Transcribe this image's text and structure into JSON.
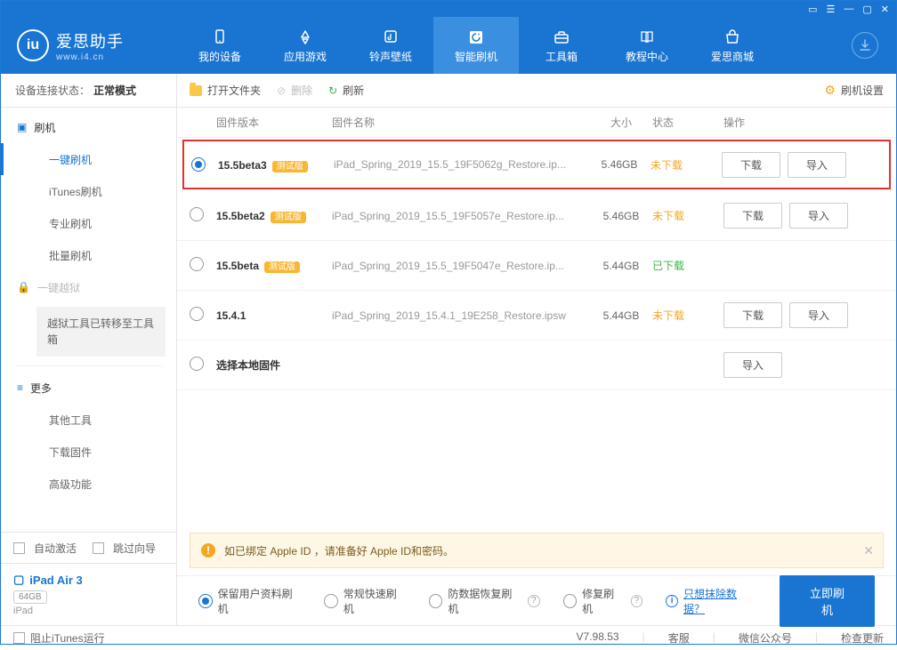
{
  "titlebar_icons": [
    "book",
    "menu",
    "min",
    "max",
    "close"
  ],
  "app": {
    "name": "爱思助手",
    "domain": "www.i4.cn"
  },
  "toptabs": [
    {
      "label": "我的设备",
      "icon": "device"
    },
    {
      "label": "应用游戏",
      "icon": "app"
    },
    {
      "label": "铃声壁纸",
      "icon": "music"
    },
    {
      "label": "智能刷机",
      "icon": "refresh",
      "active": true
    },
    {
      "label": "工具箱",
      "icon": "toolbox"
    },
    {
      "label": "教程中心",
      "icon": "book"
    },
    {
      "label": "爱思商城",
      "icon": "shop"
    }
  ],
  "sidebar": {
    "status_label": "设备连接状态：",
    "status_value": "正常模式",
    "groups": [
      {
        "head": "刷机",
        "icon": "phone",
        "subs": [
          {
            "label": "一键刷机",
            "active": true
          },
          {
            "label": "iTunes刷机"
          },
          {
            "label": "专业刷机"
          },
          {
            "label": "批量刷机"
          }
        ]
      },
      {
        "head": "一键越狱",
        "icon": "lock",
        "disabled": true,
        "notice": "越狱工具已转移至工具箱"
      },
      {
        "head": "更多",
        "icon": "more",
        "subs": [
          {
            "label": "其他工具"
          },
          {
            "label": "下载固件"
          },
          {
            "label": "高级功能"
          }
        ]
      }
    ],
    "auto_activate": "自动激活",
    "skip_guide": "跳过向导",
    "device": {
      "name": "iPad Air 3",
      "storage": "64GB",
      "type": "iPad"
    }
  },
  "toolbar": {
    "open": "打开文件夹",
    "delete": "删除",
    "refresh": "刷新",
    "settings": "刷机设置"
  },
  "columns": {
    "ver": "固件版本",
    "name": "固件名称",
    "size": "大小",
    "status": "状态",
    "ops": "操作"
  },
  "firmware": [
    {
      "selected": true,
      "highlight": true,
      "version": "15.5beta3",
      "beta": true,
      "name": "iPad_Spring_2019_15.5_19F5062g_Restore.ip...",
      "size": "5.46GB",
      "status": "未下载",
      "status_class": "und",
      "download": true,
      "import": true
    },
    {
      "version": "15.5beta2",
      "beta": true,
      "name": "iPad_Spring_2019_15.5_19F5057e_Restore.ip...",
      "size": "5.46GB",
      "status": "未下载",
      "status_class": "und",
      "download": true,
      "import": true
    },
    {
      "version": "15.5beta",
      "beta": true,
      "name": "iPad_Spring_2019_15.5_19F5047e_Restore.ip...",
      "size": "5.44GB",
      "status": "已下载",
      "status_class": "done"
    },
    {
      "version": "15.4.1",
      "name": "iPad_Spring_2019_15.4.1_19E258_Restore.ipsw",
      "size": "5.44GB",
      "status": "未下载",
      "status_class": "und",
      "download": true,
      "import": true
    },
    {
      "local": true,
      "version": "选择本地固件",
      "import": true
    }
  ],
  "beta_label": "测试版",
  "btn_download": "下载",
  "btn_import": "导入",
  "banner": "如已绑定 Apple ID ，请准备好 Apple ID和密码。",
  "flash_opts": [
    {
      "label": "保留用户资料刷机",
      "checked": true
    },
    {
      "label": "常规快速刷机"
    },
    {
      "label": "防数据恢复刷机",
      "q": true
    },
    {
      "label": "修复刷机",
      "q": true
    }
  ],
  "erase_link": "只想抹除数据？",
  "flash_btn": "立即刷机",
  "statusbar": {
    "block_itunes": "阻止iTunes运行",
    "version": "V7.98.53",
    "links": [
      "客服",
      "微信公众号",
      "检查更新"
    ]
  }
}
